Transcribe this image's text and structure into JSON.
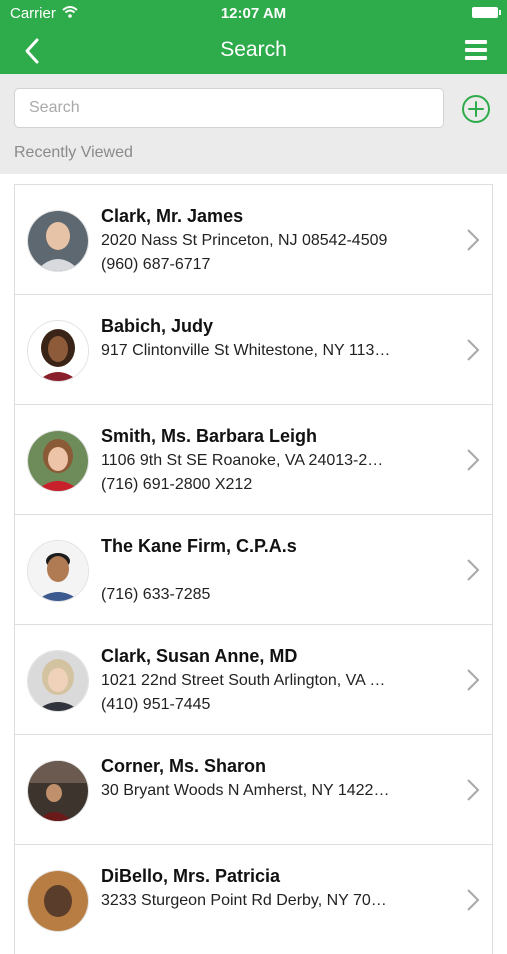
{
  "status_bar": {
    "carrier": "Carrier",
    "time": "12:07 AM"
  },
  "header": {
    "title": "Search",
    "back_icon": "chevron-left-icon",
    "menu_icon": "hamburger-menu-icon"
  },
  "search": {
    "placeholder": "Search",
    "value": "",
    "add_icon": "plus-circle-icon"
  },
  "section_label": "Recently Viewed",
  "colors": {
    "brand_green": "#2eab4b",
    "section_background": "#ebebeb"
  },
  "contacts": [
    {
      "name": "Clark, Mr. James",
      "address": "2020 Nass St Princeton, NJ 08542-4509",
      "phone": "(960) 687-6717"
    },
    {
      "name": "Babich, Judy",
      "address": "917 Clintonville St Whitestone, NY 113…",
      "phone": ""
    },
    {
      "name": "Smith, Ms. Barbara Leigh",
      "address": "1106 9th St SE Roanoke, VA 24013-2…",
      "phone": "(716) 691-2800 X212"
    },
    {
      "name": "The Kane Firm, C.P.A.s",
      "address": "",
      "phone": "(716) 633-7285"
    },
    {
      "name": "Clark, Susan Anne, MD",
      "address": "1021 22nd Street South Arlington, VA …",
      "phone": "(410) 951-7445"
    },
    {
      "name": "Corner, Ms. Sharon",
      "address": "30 Bryant Woods N Amherst, NY 1422…",
      "phone": ""
    },
    {
      "name": "DiBello, Mrs. Patricia",
      "address": "3233 Sturgeon Point Rd Derby, NY 70…",
      "phone": ""
    }
  ]
}
